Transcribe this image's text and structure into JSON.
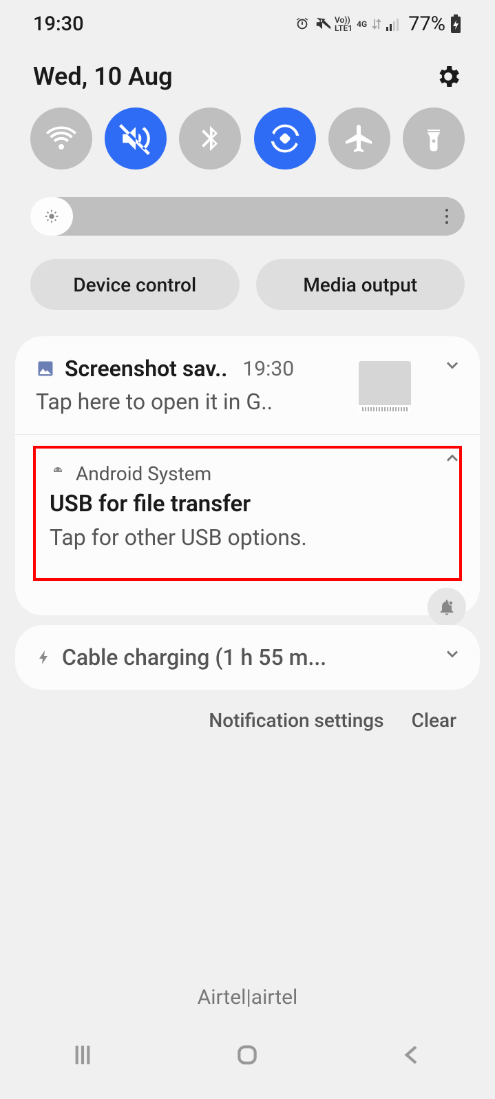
{
  "status": {
    "time": "19:30",
    "volte": "Vo))\nLTE1",
    "net": "4G",
    "battery": "77%"
  },
  "header": {
    "date": "Wed, 10 Aug"
  },
  "pills": {
    "device_control": "Device control",
    "media_output": "Media output"
  },
  "notifications": {
    "screenshot": {
      "title": "Screenshot sav..",
      "time": "19:30",
      "body": "Tap here to open it in G.."
    },
    "usb": {
      "app": "Android System",
      "title": "USB for file transfer",
      "body": "Tap for other USB options."
    },
    "charging": {
      "title": "Cable charging (1 h 55 m..."
    }
  },
  "footer": {
    "settings": "Notification settings",
    "clear": "Clear"
  },
  "carrier": "Airtel|airtel"
}
